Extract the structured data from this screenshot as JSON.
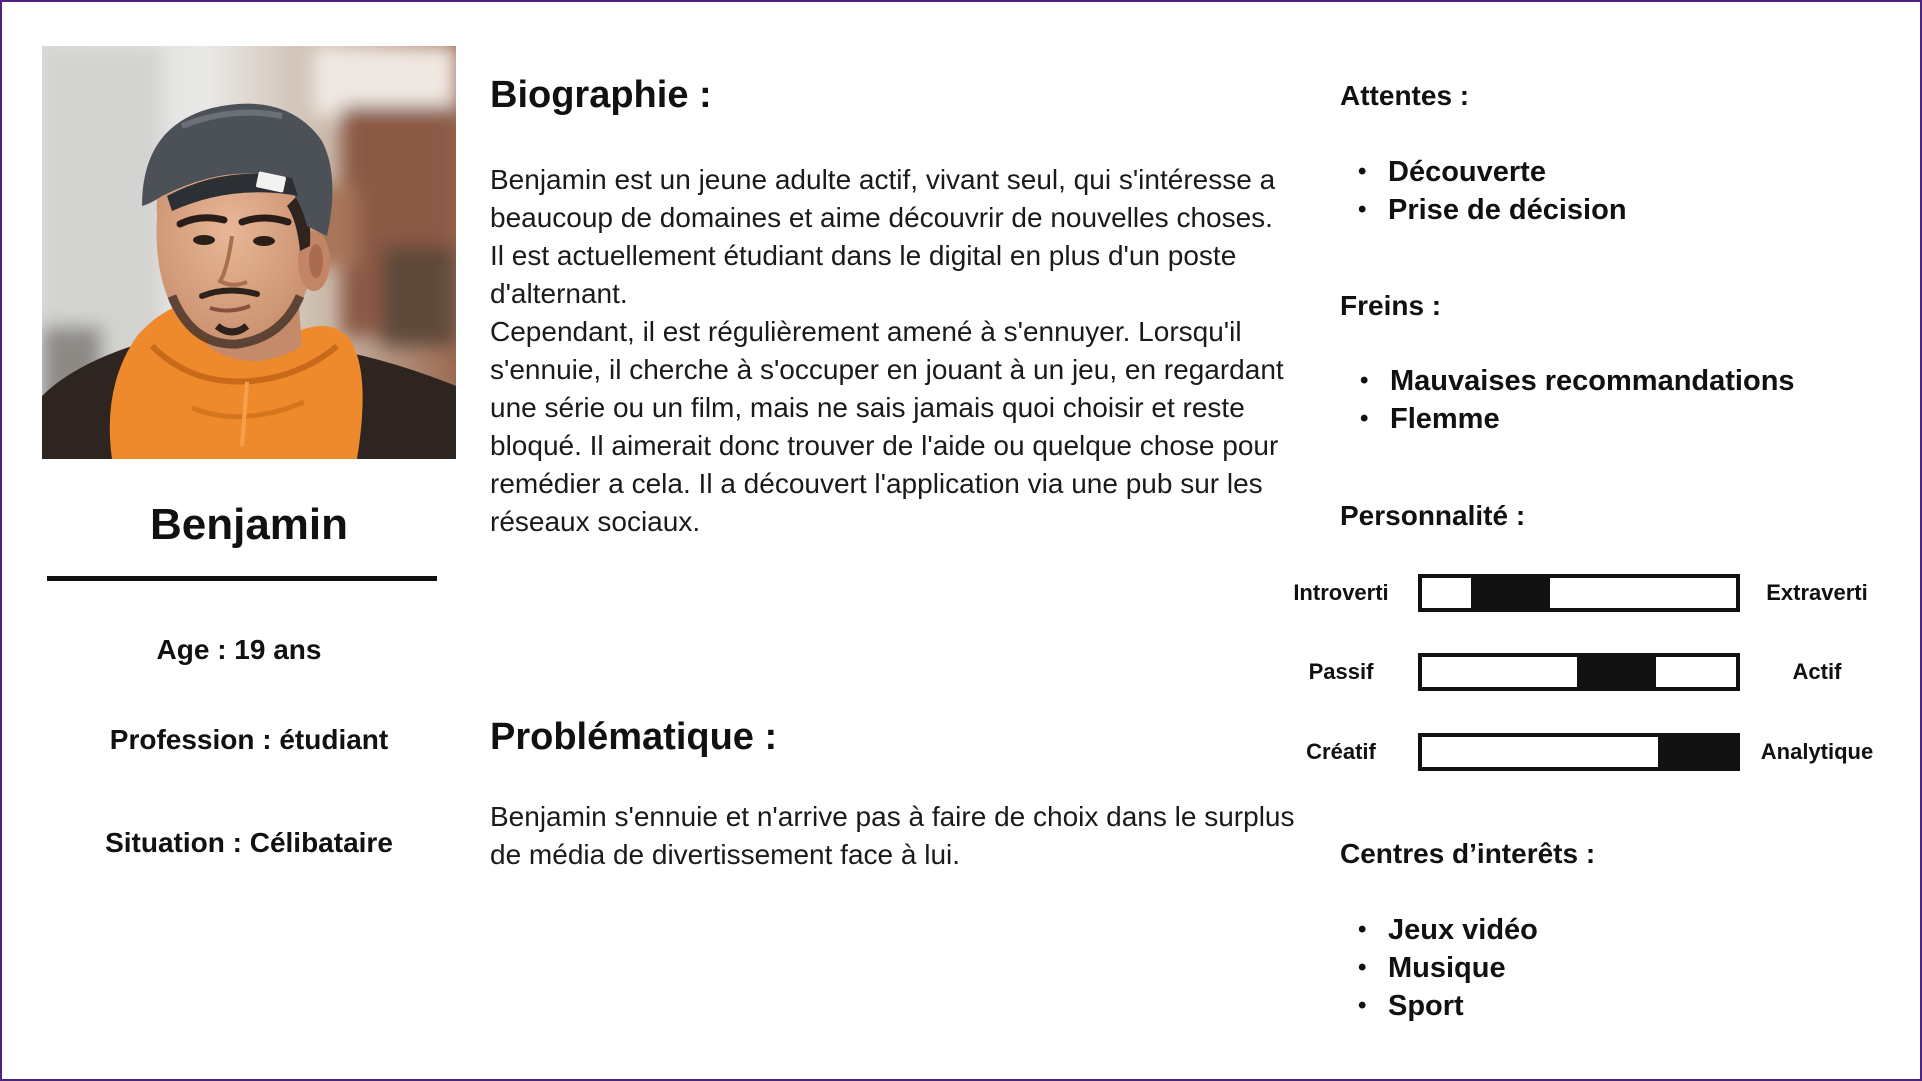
{
  "profile": {
    "name": "Benjamin",
    "age": "Age : 19 ans",
    "profession": "Profession : étudiant",
    "situation": "Situation : Célibataire"
  },
  "biography": {
    "title": "Biographie :",
    "paragraphs": [
      "Benjamin est un jeune adulte actif, vivant seul, qui s'intéresse a beaucoup de domaines et aime découvrir de nouvelles choses. Il est actuellement étudiant dans le digital en plus d'un poste d'alternant.",
      "Cependant, il est régulièrement amené à s'ennuyer. Lorsqu'il s'ennuie, il cherche à s'occuper en jouant à un jeu, en regardant une série ou un film, mais ne sais jamais quoi choisir et reste bloqué. Il aimerait donc trouver de l'aide ou quelque chose pour remédier a cela. Il a découvert l'application via une pub sur les réseaux sociaux."
    ]
  },
  "problem": {
    "title": "Problématique :",
    "text": "Benjamin s'ennuie et n'arrive pas à faire de choix dans le surplus de média de divertissement face à lui."
  },
  "expectations": {
    "title": "Attentes :",
    "items": [
      "Découverte",
      "Prise de décision"
    ]
  },
  "obstacles": {
    "title": "Freins :",
    "items": [
      "Mauvaises recommandations",
      "Flemme"
    ]
  },
  "personality": {
    "title": "Personnalité :",
    "traits": [
      {
        "left": "Introverti",
        "right": "Extraverti",
        "value": 0.21
      },
      {
        "left": "Passif",
        "right": "Actif",
        "value": 0.66
      },
      {
        "left": "Créatif",
        "right": "Analytique",
        "value": 1.0
      }
    ]
  },
  "interests": {
    "title": "Centres d’interêts :",
    "items": [
      "Jeux vidéo",
      "Musique",
      "Sport"
    ]
  },
  "colors": {
    "text": "#111111",
    "frame_border": "#4a2384",
    "hoodie": "#ee8a2c"
  }
}
